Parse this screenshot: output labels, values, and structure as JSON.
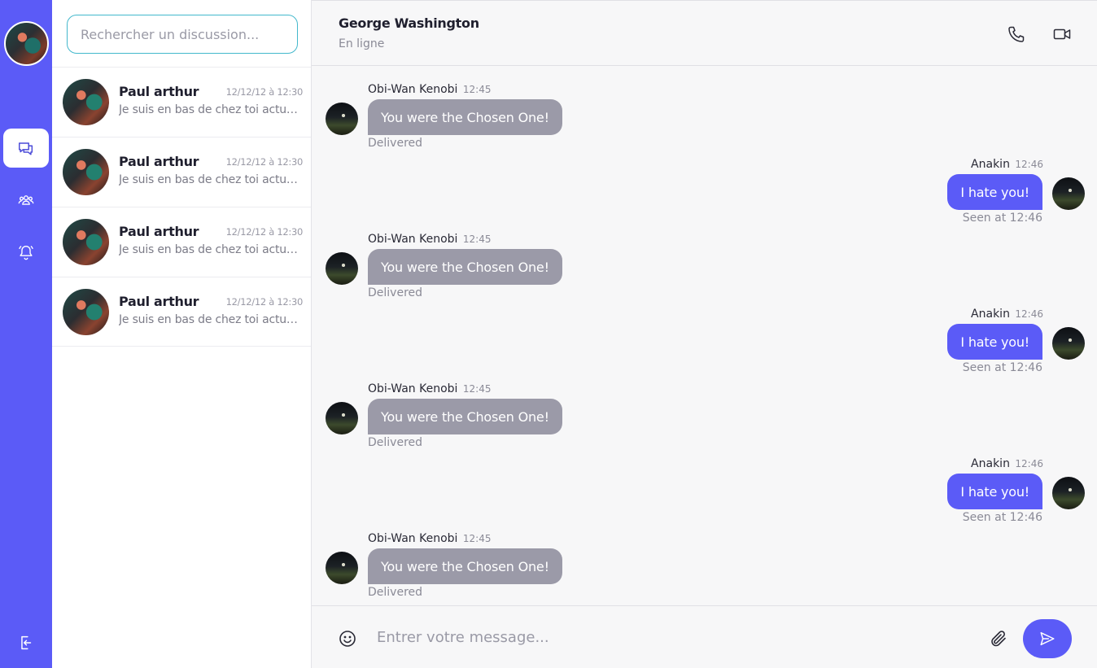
{
  "sidebar": {
    "nav": [
      {
        "icon": "chat-bubbles-icon",
        "active": true
      },
      {
        "icon": "users-group-icon",
        "active": false
      },
      {
        "icon": "bell-icon",
        "active": false
      },
      {
        "icon": "logout-icon",
        "active": false
      }
    ],
    "accent": "#5b5bf7"
  },
  "search": {
    "placeholder": "Rechercher un discussion..."
  },
  "conversations": [
    {
      "name": "Paul arthur",
      "date": "12/12/12 à 12:30",
      "preview": "Je suis en bas de chez toi actuellement"
    },
    {
      "name": "Paul arthur",
      "date": "12/12/12 à 12:30",
      "preview": "Je suis en bas de chez toi actuellement"
    },
    {
      "name": "Paul arthur",
      "date": "12/12/12 à 12:30",
      "preview": "Je suis en bas de chez toi actuellement"
    },
    {
      "name": "Paul arthur",
      "date": "12/12/12 à 12:30",
      "preview": "Je suis en bas de chez toi actuellement"
    }
  ],
  "chat": {
    "contact_name": "George Washington",
    "contact_status": "En ligne",
    "icons": [
      "phone-icon",
      "video-camera-icon"
    ],
    "messages": [
      {
        "direction": "in",
        "sender": "Obi-Wan Kenobi",
        "time": "12:45",
        "text": "You were the Chosen One!",
        "status": "Delivered"
      },
      {
        "direction": "out",
        "sender": "Anakin",
        "time": "12:46",
        "text": "I hate you!",
        "status": "Seen at 12:46"
      },
      {
        "direction": "in",
        "sender": "Obi-Wan Kenobi",
        "time": "12:45",
        "text": "You were the Chosen One!",
        "status": "Delivered"
      },
      {
        "direction": "out",
        "sender": "Anakin",
        "time": "12:46",
        "text": "I hate you!",
        "status": "Seen at 12:46"
      },
      {
        "direction": "in",
        "sender": "Obi-Wan Kenobi",
        "time": "12:45",
        "text": "You were the Chosen One!",
        "status": "Delivered"
      },
      {
        "direction": "out",
        "sender": "Anakin",
        "time": "12:46",
        "text": "I hate you!",
        "status": "Seen at 12:46"
      },
      {
        "direction": "in",
        "sender": "Obi-Wan Kenobi",
        "time": "12:45",
        "text": "You were the Chosen One!",
        "status": "Delivered"
      }
    ]
  },
  "composer": {
    "placeholder": "Entrer votre message...",
    "icons": [
      "emoji-icon",
      "paperclip-icon",
      "send-icon"
    ]
  }
}
